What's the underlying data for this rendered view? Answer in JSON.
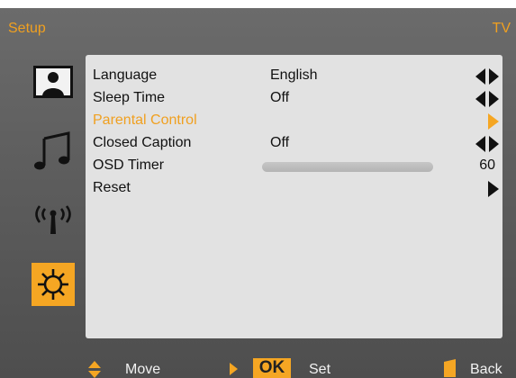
{
  "header": {
    "title": "Setup",
    "source": "TV"
  },
  "sidebar": {
    "items": [
      {
        "icon": "picture-icon",
        "active": false
      },
      {
        "icon": "music-note-icon",
        "active": false
      },
      {
        "icon": "antenna-icon",
        "active": false
      },
      {
        "icon": "gear-icon",
        "active": true
      }
    ]
  },
  "menu": {
    "items": [
      {
        "label": "Language",
        "value": "English"
      },
      {
        "label": "Sleep Time",
        "value": "Off"
      },
      {
        "label": "Parental Control",
        "value": ""
      },
      {
        "label": "Closed Caption",
        "value": "Off"
      },
      {
        "label": "OSD Timer",
        "value": "60"
      },
      {
        "label": "Reset",
        "value": ""
      }
    ]
  },
  "footer": {
    "move_label": "Move",
    "ok_label": "OK",
    "set_label": "Set",
    "back_label": "Back"
  },
  "colors": {
    "accent": "#F5A623",
    "panel": "#E2E2E2",
    "background": "#5D5D5D"
  }
}
